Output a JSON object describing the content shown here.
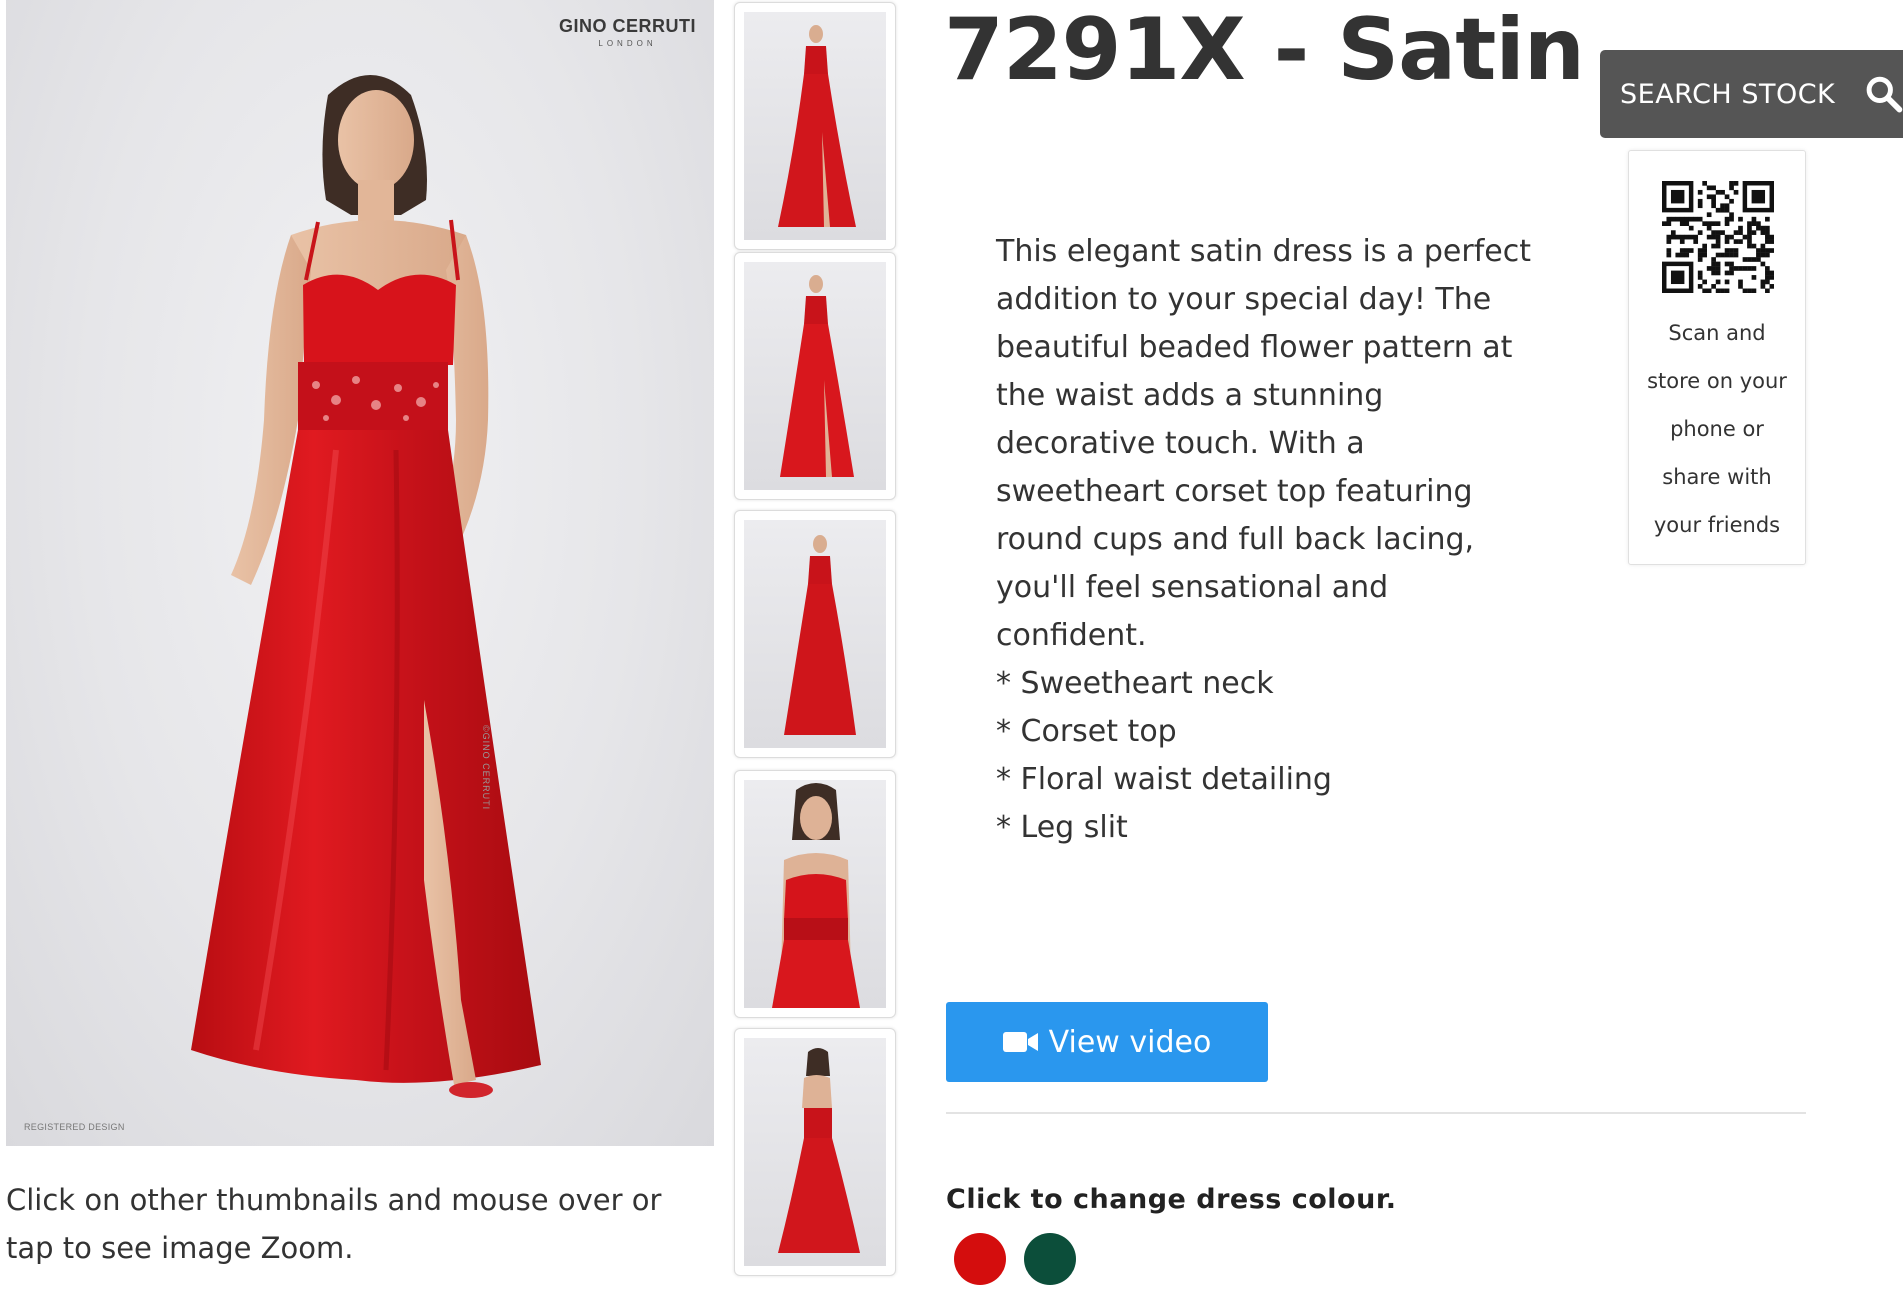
{
  "product": {
    "title": "7291X - Satin",
    "description": "This elegant satin dress is a perfect addition to your special day! The beautiful beaded flower pattern at the waist adds a stunning decorative touch. With a sweetheart corset top featuring round cups and full back lacing, you'll feel sensational and confident.",
    "features": [
      "* Sweetheart neck",
      "* Corset top",
      "* Floral waist detailing",
      "* Leg slit"
    ]
  },
  "gallery": {
    "brand_name": "GINO CERRUTI",
    "brand_sub": "LONDON",
    "registered": "REGISTERED DESIGN",
    "side_watermark": "©GINO CERRUTI",
    "zoom_hint": "Click on other thumbnails and mouse over or tap to see image Zoom.",
    "thumbnails": [
      "front-slit",
      "front-slit-2",
      "side-pose",
      "close-up",
      "back-lacing"
    ]
  },
  "video_button": {
    "label": "View video",
    "icon": "video-camera-icon"
  },
  "colours": {
    "heading": "Click to change dress colour.",
    "swatches": [
      {
        "name": "red",
        "color": "#d40d0d"
      },
      {
        "name": "green",
        "color": "#0c4e3a"
      }
    ]
  },
  "search": {
    "label": "SEARCH STOCK",
    "icon": "search-icon"
  },
  "qr": {
    "lines": [
      "Scan and",
      "store on your",
      "phone or",
      "share with",
      "your friends"
    ]
  },
  "theme": {
    "dress_red": "#d8141a",
    "button_blue": "#2a97ee",
    "search_grey": "#555555"
  }
}
